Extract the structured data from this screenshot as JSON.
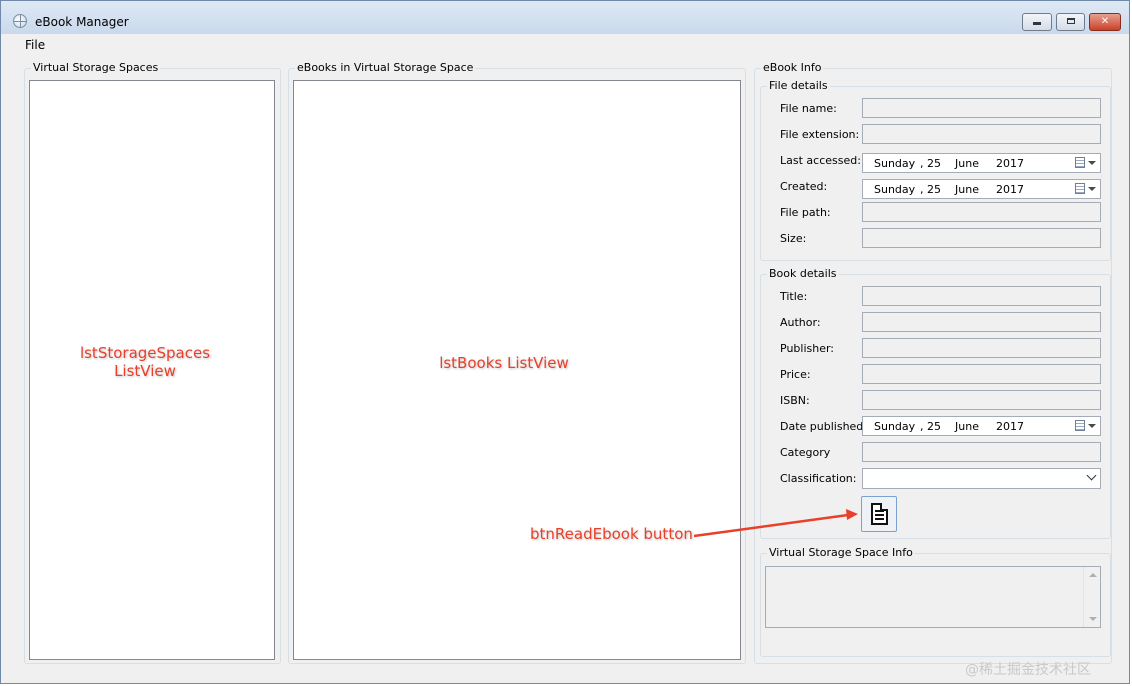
{
  "window": {
    "title": "eBook Manager",
    "controls": {
      "minimize": "",
      "maximize": "",
      "close": "✕"
    }
  },
  "menu": {
    "items": [
      "File"
    ]
  },
  "storage_spaces": {
    "caption": "Virtual Storage Spaces",
    "annotation_line1": "lstStorageSpaces",
    "annotation_line2": "ListView"
  },
  "books": {
    "caption": "eBooks in Virtual Storage Space",
    "annotation": "lstBooks ListView"
  },
  "ebook_info": {
    "caption": "eBook Info",
    "file_details": {
      "caption": "File details",
      "file_name_label": "File name:",
      "file_extension_label": "File extension:",
      "last_accessed_label": "Last accessed:",
      "last_accessed": {
        "day": "Sunday",
        "date": ", 25",
        "month": "June",
        "year": "2017"
      },
      "created_label": "Created:",
      "created": {
        "day": "Sunday",
        "date": ", 25",
        "month": "June",
        "year": "2017"
      },
      "file_path_label": "File path:",
      "size_label": "Size:"
    },
    "book_details": {
      "caption": "Book details",
      "title_label": "Title:",
      "author_label": "Author:",
      "publisher_label": "Publisher:",
      "price_label": "Price:",
      "isbn_label": "ISBN:",
      "date_published_label": "Date published:",
      "date_published": {
        "day": "Sunday",
        "date": ", 25",
        "month": "June",
        "year": "2017"
      },
      "category_label": "Category",
      "classification_label": "Classification:",
      "read_button_annotation": "btnReadEbook button"
    }
  },
  "storage_space_info": {
    "caption": "Virtual Storage Space Info"
  },
  "watermark": "@稀土掘金技术社区",
  "colors": {
    "annotation": "#e8402a",
    "titlebar": "#c9d9ec",
    "close_button": "#c9412a"
  },
  "icons": {
    "app": "globe-icon",
    "read": "document-icon",
    "calendar": "calendar-icon"
  }
}
